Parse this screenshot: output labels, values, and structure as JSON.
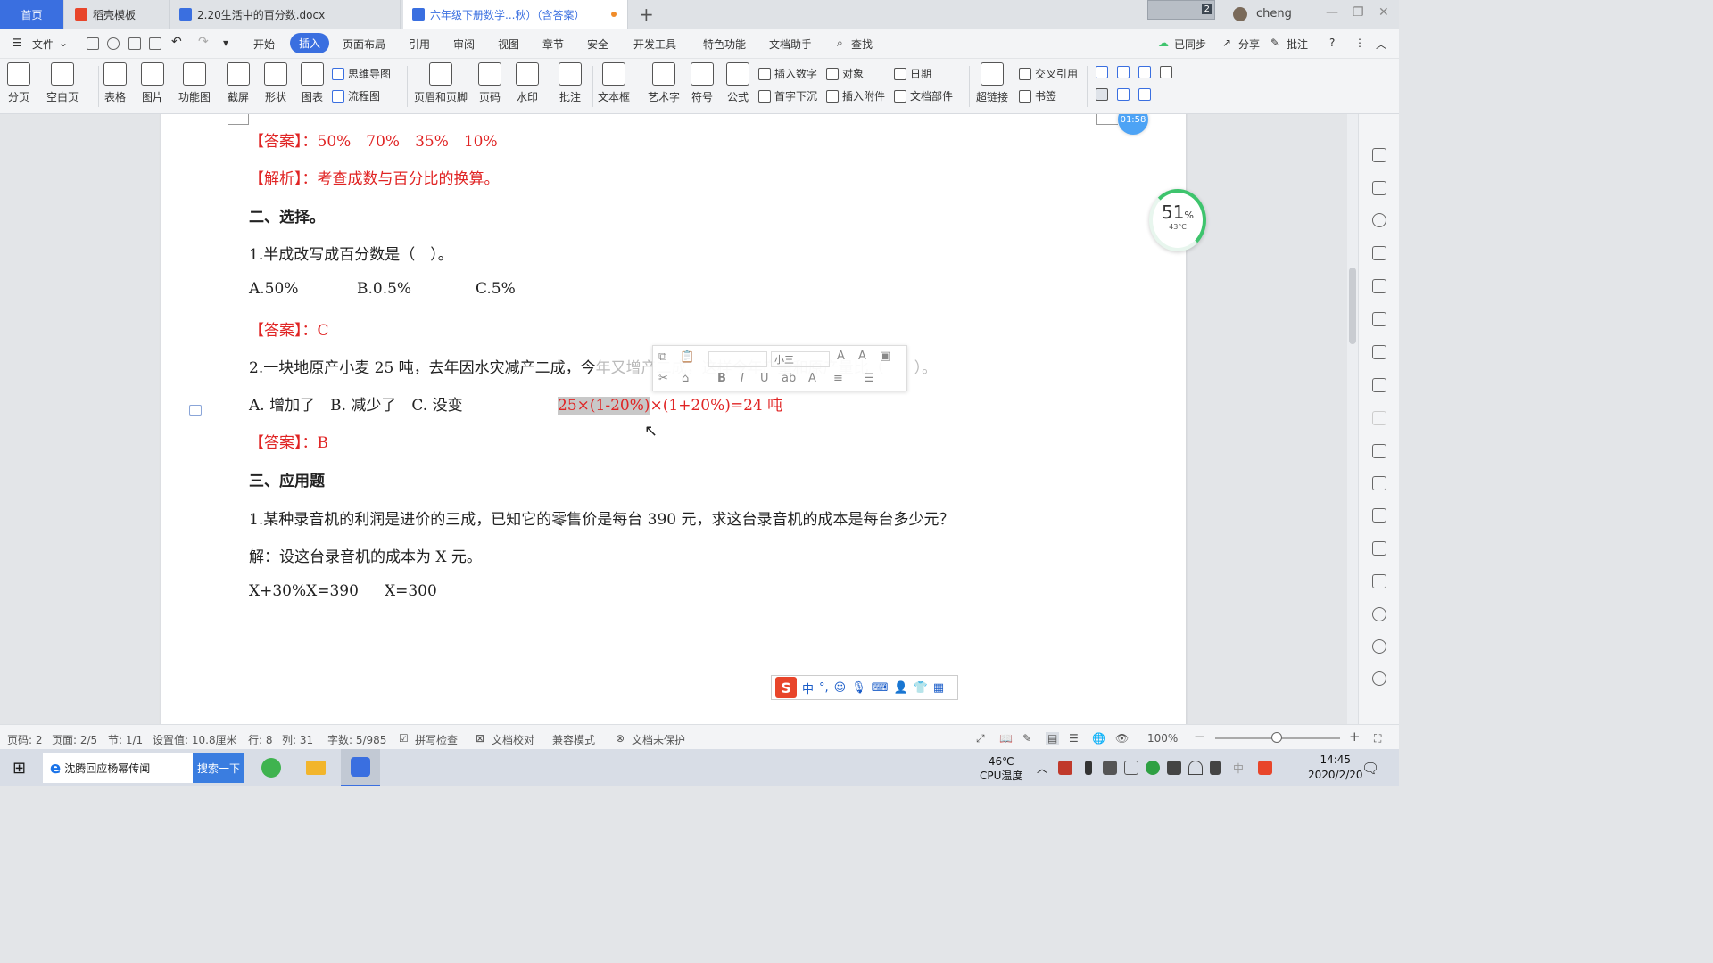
{
  "tabs": {
    "home": "首页",
    "daoke": "稻壳模板",
    "doc1": "2.20生活中的百分数.docx",
    "doc2": "六年级下册数学...秋）（含答案）"
  },
  "user": {
    "badge": "2",
    "name": "cheng"
  },
  "menu": {
    "file": "文件",
    "items": [
      "开始",
      "插入",
      "页面布局",
      "引用",
      "审阅",
      "视图",
      "章节",
      "安全",
      "开发工具",
      "特色功能",
      "文档助手"
    ],
    "find": "查找",
    "synced": "已同步",
    "share": "分享",
    "comment": "批注"
  },
  "ribbon": {
    "page_break": "分页",
    "blank_page": "空白页",
    "table": "表格",
    "picture": "图片",
    "function_chart": "功能图",
    "screenshot": "截屏",
    "shape": "形状",
    "chart": "图表",
    "mindmap": "思维导图",
    "flowchart": "流程图",
    "header_footer": "页眉和页脚",
    "page_number": "页码",
    "watermark": "水印",
    "annotation": "批注",
    "textbox": "文本框",
    "wordart": "艺术字",
    "symbol": "符号",
    "formula": "公式",
    "insert_number": "插入数字",
    "object": "对象",
    "date": "日期",
    "dropcap": "首字下沉",
    "attachment": "插入附件",
    "doc_parts": "文档部件",
    "hyperlink": "超链接",
    "crossref": "交叉引用",
    "bookmark": "书签"
  },
  "document": {
    "l1": "【答案】：50%　70%　35%　10%",
    "l2": "【解析】：考查成数与百分比的换算。",
    "l3": "二、选择。",
    "l4": "1.半成改写成百分数是（　）。",
    "l5a": "A.50%",
    "l5b": "B.0.5%",
    "l5c": "C.5%",
    "l6": "【答案】：C",
    "l7a": "2.一块地原产小麦 25 吨，去年因水灾减产二成，今",
    "l7b": "年又增产二成，这样今年产量和原产量比（　　）。",
    "l8": "A. 增加了　B. 减少了　C. 没变",
    "l8_hl": "25×(1-20%)",
    "l8_rest": "×(1+20%)=24 吨",
    "l9": "【答案】：B",
    "l10": "三、应用题",
    "l11": "1.某种录音机的利润是进价的三成，已知它的零售价是每台 390 元，求这台录音机的成本是每台多少元？",
    "l12": "解：设这台录音机的成本为 X 元。",
    "l13a": "X+30%X=390",
    "l13b": "X=300"
  },
  "mini_toolbar": {
    "font_size": "小三"
  },
  "overlays": {
    "timer": "01:58",
    "gauge_pct": "51",
    "gauge_unit": "%",
    "gauge_temp": "43°C",
    "ime_zh": "中"
  },
  "status": {
    "page_code": "页码: 2",
    "page": "页面: 2/5",
    "section": "节: 1/1",
    "setting": "设置值: 10.8厘米",
    "row": "行: 8",
    "col": "列: 31",
    "words": "字数: 5/985",
    "spell": "拼写检查",
    "proof": "文档校对",
    "compat": "兼容模式",
    "protect": "文档未保护",
    "zoom": "100%"
  },
  "taskbar": {
    "search_text": "沈腾回应杨幂传闻",
    "search_btn": "搜索一下",
    "cpu_temp": "46℃",
    "cpu_label": "CPU温度",
    "ime": "中",
    "time": "14:45",
    "date": "2020/2/20"
  },
  "colors": {
    "accent": "#3a6fe0",
    "answer_red": "#e02424",
    "gauge_green": "#3ec46d"
  }
}
